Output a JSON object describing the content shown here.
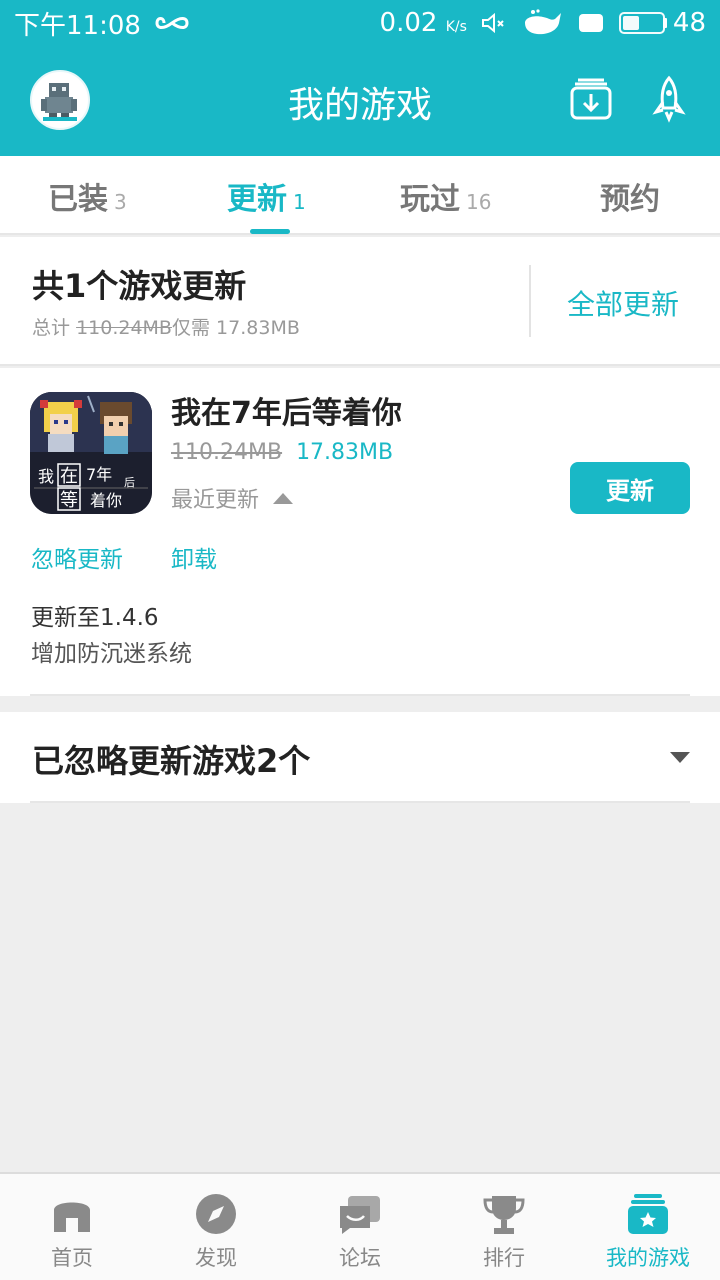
{
  "status_bar": {
    "time": "下午11:08",
    "net_speed": "0.02",
    "net_unit": "K/s",
    "battery": "48",
    "battery_level": 0.48
  },
  "app_bar": {
    "title": "我的游戏",
    "download_icon": "download-icon",
    "rocket_icon": "rocket-icon",
    "avatar_icon": "robot-avatar"
  },
  "tabs": [
    {
      "label": "已装",
      "count": "3"
    },
    {
      "label": "更新",
      "count": "1",
      "active": true
    },
    {
      "label": "玩过",
      "count": "16"
    },
    {
      "label": "预约",
      "count": ""
    }
  ],
  "summary": {
    "title": "共1个游戏更新",
    "total_label": "总计",
    "total_size": "110.24MB",
    "only_need": "仅需",
    "need_size": "17.83MB",
    "update_all": "全部更新"
  },
  "game": {
    "name": "我在7年后等着你",
    "old_size": "110.24MB",
    "new_size": "17.83MB",
    "recent_label": "最近更新",
    "update_button": "更新",
    "ignore_link": "忽略更新",
    "uninstall_link": "卸载",
    "version_note": "更新至1.4.6",
    "change_note": "增加防沉迷系统",
    "icon_text": [
      "我",
      "在",
      "7年",
      "后",
      "等",
      "着你"
    ]
  },
  "ignored": {
    "title": "已忽略更新游戏2个"
  },
  "bottom_nav": [
    {
      "label": "首页",
      "icon": "home-icon"
    },
    {
      "label": "发现",
      "icon": "compass-icon"
    },
    {
      "label": "论坛",
      "icon": "forum-icon"
    },
    {
      "label": "排行",
      "icon": "trophy-icon"
    },
    {
      "label": "我的游戏",
      "icon": "my-games-icon",
      "active": true
    }
  ],
  "colors": {
    "accent": "#19b8c6",
    "background": "#eeeeee"
  }
}
